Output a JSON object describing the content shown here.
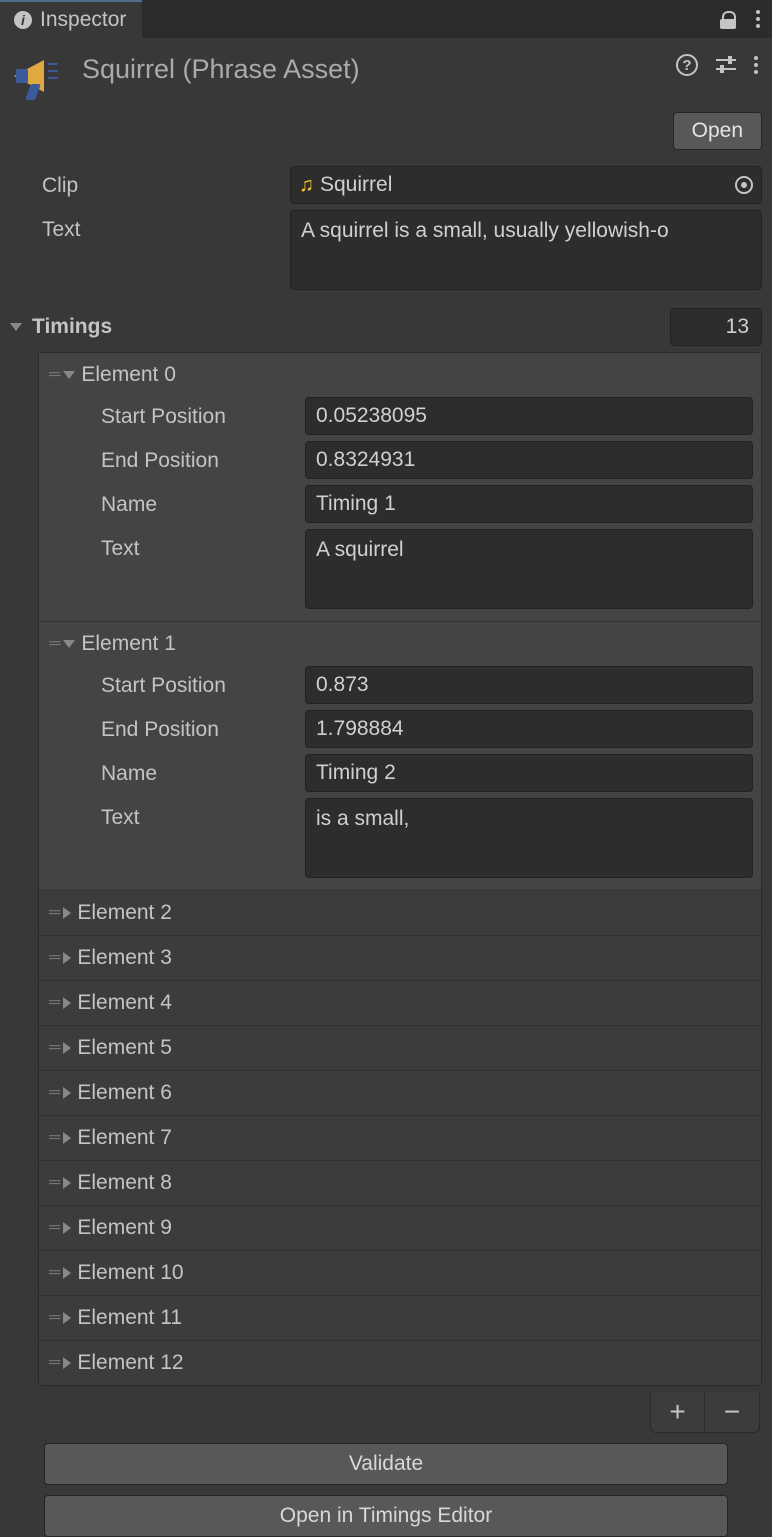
{
  "tab": {
    "label": "Inspector"
  },
  "header": {
    "title": "Squirrel (Phrase Asset)",
    "open_button": "Open"
  },
  "fields": {
    "clip_label": "Clip",
    "clip_value": "Squirrel",
    "text_label": "Text",
    "text_value": "A squirrel is a small, usually yellowish-o"
  },
  "timings": {
    "label": "Timings",
    "count": "13",
    "field_labels": {
      "start": "Start Position",
      "end": "End Position",
      "name": "Name",
      "text": "Text"
    },
    "elements": [
      {
        "label": "Element 0",
        "expanded": true,
        "start": "0.05238095",
        "end": "0.8324931",
        "name": "Timing 1",
        "text": "A squirrel"
      },
      {
        "label": "Element 1",
        "expanded": true,
        "start": "0.873",
        "end": "1.798884",
        "name": "Timing 2",
        "text": "is a small,"
      },
      {
        "label": "Element 2",
        "expanded": false
      },
      {
        "label": "Element 3",
        "expanded": false
      },
      {
        "label": "Element 4",
        "expanded": false
      },
      {
        "label": "Element 5",
        "expanded": false
      },
      {
        "label": "Element 6",
        "expanded": false
      },
      {
        "label": "Element 7",
        "expanded": false
      },
      {
        "label": "Element 8",
        "expanded": false
      },
      {
        "label": "Element 9",
        "expanded": false
      },
      {
        "label": "Element 10",
        "expanded": false
      },
      {
        "label": "Element 11",
        "expanded": false
      },
      {
        "label": "Element 12",
        "expanded": false
      }
    ]
  },
  "buttons": {
    "validate": "Validate",
    "open_editor": "Open in Timings Editor"
  }
}
